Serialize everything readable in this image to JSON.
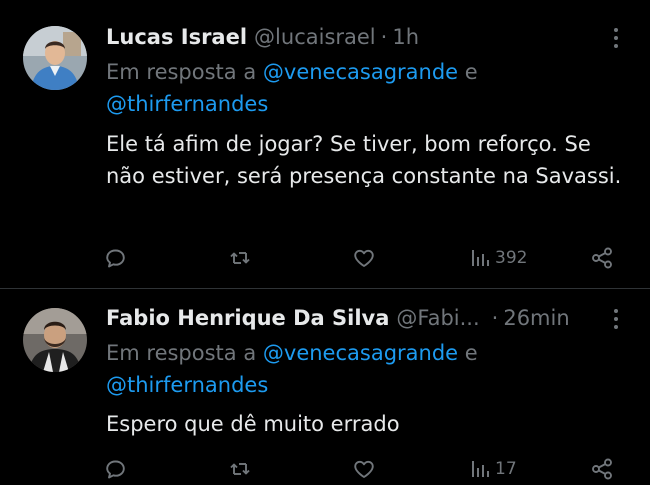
{
  "tweets": [
    {
      "author_name": "Lucas Israel",
      "handle": "@lucaisrael",
      "separator": "·",
      "time": "1h",
      "reply_prefix": "Em resposta a",
      "mention_1": "@venecasagrande",
      "reply_conjunction": "e",
      "mention_2": "@thirfernandes",
      "text": "Ele tá afim de jogar? Se tiver, bom reforço. Se não estiver, será presença constante na Savassi.",
      "views": "392"
    },
    {
      "author_name": "Fabio Henrique Da Silva",
      "handle": "@Fabi...",
      "separator": "·",
      "time": "26min",
      "reply_prefix": "Em resposta a",
      "mention_1": "@venecasagrande",
      "reply_conjunction": "e",
      "mention_2": "@thirfernandes",
      "text": "Espero que dê muito errado",
      "views": "17"
    }
  ],
  "icons": {
    "more": "more-vertical-icon",
    "reply": "reply-icon",
    "retweet": "retweet-icon",
    "like": "heart-icon",
    "views": "views-icon",
    "share": "share-icon"
  },
  "colors": {
    "background": "#000000",
    "primary_text": "#e7e9ea",
    "secondary_text": "#71767b",
    "link": "#1d9bf0",
    "divider": "#2f3336"
  }
}
